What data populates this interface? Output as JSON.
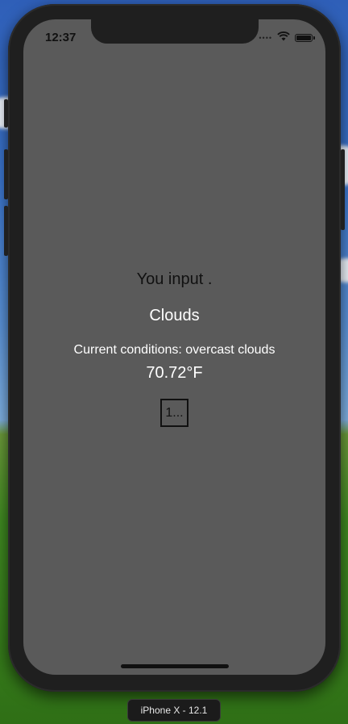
{
  "status_bar": {
    "time": "12:37",
    "icons": [
      "cellular-dots-icon",
      "wifi-icon",
      "battery-icon"
    ]
  },
  "app": {
    "you_input": "You input .",
    "main_weather": "Clouds",
    "conditions": "Current conditions: overcast clouds",
    "temperature": "70.72°F",
    "box_text": "1..."
  },
  "simulator": {
    "device_label": "iPhone X - 12.1"
  },
  "colors": {
    "screen_background": "#5a5a5a",
    "device_bezel": "#1f1f1f",
    "text_dark": "#111111",
    "text_light": "#ffffff"
  }
}
